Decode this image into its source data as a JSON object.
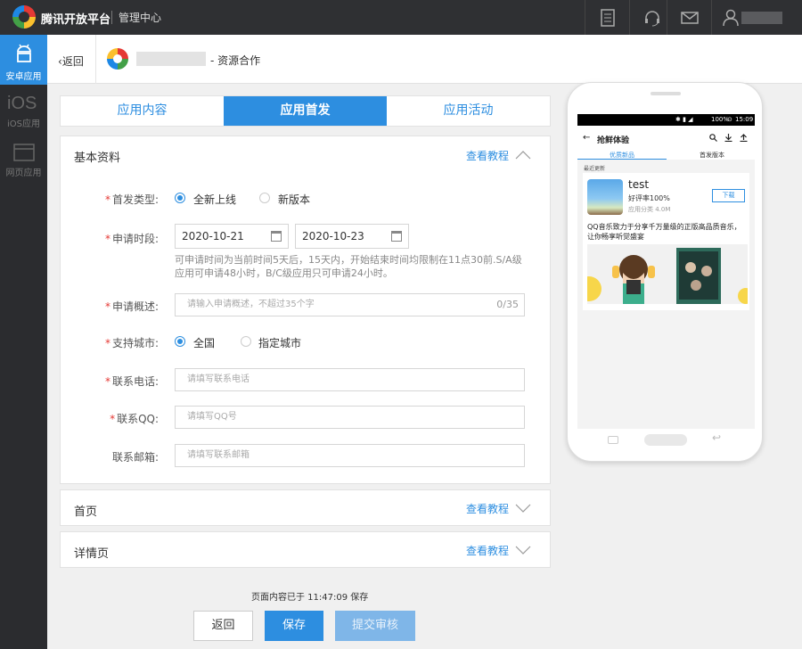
{
  "topbar": {
    "brand": "腾讯开放平台",
    "subtitle": "管理中心",
    "icons": [
      "document-icon",
      "headset-icon",
      "mail-icon",
      "user-icon"
    ]
  },
  "sidebar": {
    "items": [
      {
        "label": "安卓应用",
        "icon": "android-icon",
        "active": true
      },
      {
        "label": "iOS应用",
        "icon": "ios-icon",
        "active": false
      },
      {
        "label": "网页应用",
        "icon": "web-icon",
        "active": false
      }
    ]
  },
  "subheader": {
    "back_label": "返回",
    "crumb": "- 资源合作"
  },
  "tabs": [
    {
      "label": "应用内容",
      "active": false
    },
    {
      "label": "应用首发",
      "active": true
    },
    {
      "label": "应用活动",
      "active": false
    }
  ],
  "basic": {
    "title": "基本资料",
    "tutorial": "查看教程",
    "launch_type": {
      "label": "首发类型:",
      "options": [
        "全新上线",
        "新版本"
      ],
      "selected": 0
    },
    "period": {
      "label": "申请时段:",
      "start": "2020-10-21",
      "end": "2020-10-23",
      "hint": "可申请时间为当前时间5天后，15天内，开始结束时间均限制在11点30前.S/A级应用可申请48小时，B/C级应用只可申请24小时。"
    },
    "summary": {
      "label": "申请概述:",
      "placeholder": "请输入申请概述，不超过35个字",
      "counter": "0/35"
    },
    "city": {
      "label": "支持城市:",
      "options": [
        "全国",
        "指定城市"
      ],
      "selected": 0
    },
    "phone": {
      "label": "联系电话:",
      "placeholder": "请填写联系电话"
    },
    "qq": {
      "label": "联系QQ:",
      "placeholder": "请填写QQ号"
    },
    "email": {
      "label": "联系邮箱:",
      "placeholder": "请填写联系邮箱"
    }
  },
  "homepage": {
    "title": "首页",
    "tutorial": "查看教程"
  },
  "detail": {
    "title": "详情页",
    "tutorial": "查看教程"
  },
  "footer": {
    "save_status": "页面内容已于 11:47:09 保存",
    "back_label": "返回",
    "save_label": "保存",
    "submit_label": "提交审核"
  },
  "preview": {
    "status_battery": "100%",
    "status_time": "15:09",
    "title": "抢鲜体验",
    "tabs": [
      "优质新品",
      "首发版本"
    ],
    "section": "最近更新",
    "app_name": "test",
    "rating": "好评率100%",
    "meta": "应用分类 4.0M",
    "download": "下载",
    "description": "QQ音乐致力于分享千万量级的正版高品质音乐，让你畅享听觉盛宴"
  }
}
